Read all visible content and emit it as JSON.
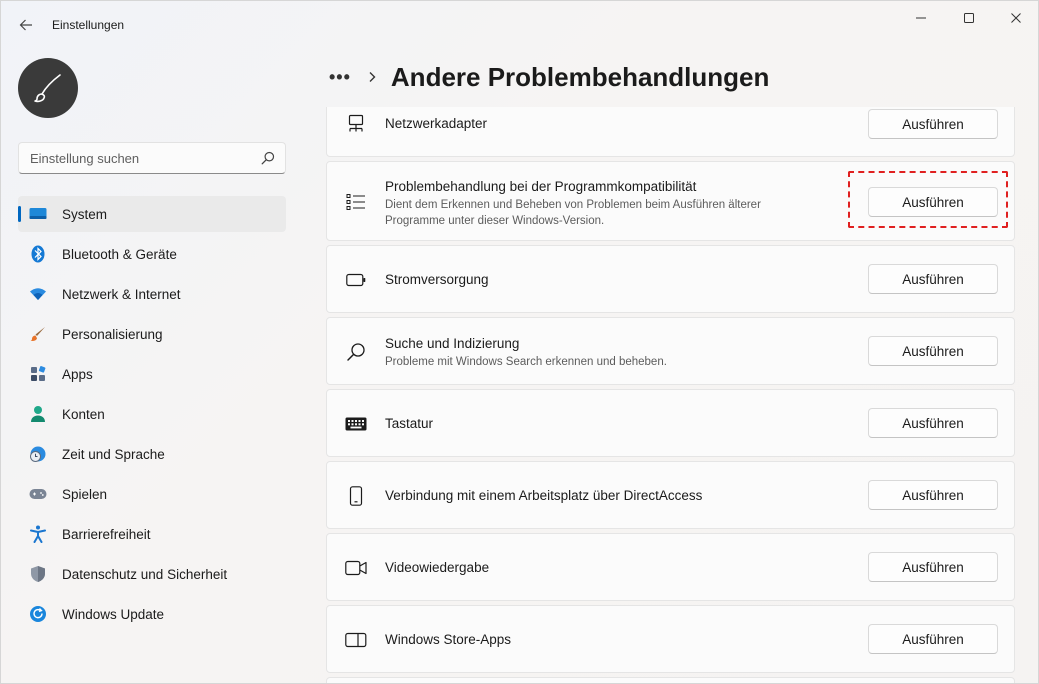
{
  "titlebar": {
    "title": "Einstellungen"
  },
  "search": {
    "placeholder": "Einstellung suchen"
  },
  "nav": [
    {
      "label": "System",
      "icon": "monitor-icon",
      "active": true
    },
    {
      "label": "Bluetooth & Geräte",
      "icon": "bluetooth-icon"
    },
    {
      "label": "Netzwerk & Internet",
      "icon": "wifi-icon"
    },
    {
      "label": "Personalisierung",
      "icon": "brush-icon"
    },
    {
      "label": "Apps",
      "icon": "apps-icon"
    },
    {
      "label": "Konten",
      "icon": "person-icon"
    },
    {
      "label": "Zeit und Sprache",
      "icon": "globe-clock-icon"
    },
    {
      "label": "Spielen",
      "icon": "gamepad-icon"
    },
    {
      "label": "Barrierefreiheit",
      "icon": "accessibility-icon"
    },
    {
      "label": "Datenschutz und Sicherheit",
      "icon": "shield-icon"
    },
    {
      "label": "Windows Update",
      "icon": "update-icon"
    }
  ],
  "breadcrumb": {
    "more": "•••",
    "title": "Andere Problembehandlungen"
  },
  "troubleshooters": [
    {
      "title": "Netzwerkadapter",
      "icon": "network-adapter-icon",
      "button": "Ausführen"
    },
    {
      "title": "Problembehandlung bei der Programmkompatibilität",
      "description": "Dient dem Erkennen und Beheben von Problemen beim Ausführen älterer Programme unter dieser Windows-Version.",
      "icon": "list-icon",
      "button": "Ausführen",
      "highlighted": true
    },
    {
      "title": "Stromversorgung",
      "icon": "battery-icon",
      "button": "Ausführen"
    },
    {
      "title": "Suche und Indizierung",
      "description": "Probleme mit Windows Search erkennen und beheben.",
      "icon": "search-icon",
      "button": "Ausführen"
    },
    {
      "title": "Tastatur",
      "icon": "keyboard-icon",
      "button": "Ausführen"
    },
    {
      "title": "Verbindung mit einem Arbeitsplatz über DirectAccess",
      "icon": "phone-icon",
      "button": "Ausführen"
    },
    {
      "title": "Videowiedergabe",
      "icon": "video-icon",
      "button": "Ausführen"
    },
    {
      "title": "Windows Store-Apps",
      "icon": "store-apps-icon",
      "button": "Ausführen"
    }
  ],
  "colors": {
    "accent": "#0067c0",
    "highlight": "#e02020"
  }
}
